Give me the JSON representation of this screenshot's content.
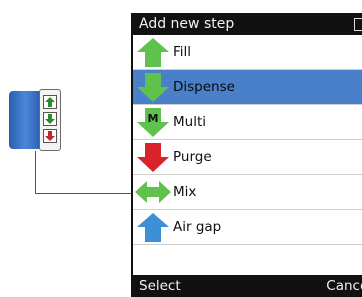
{
  "menu": {
    "title": "Add new step",
    "items": [
      {
        "label": "Fill",
        "icon": "fill-up-arrow-icon",
        "selected": false
      },
      {
        "label": "Dispense",
        "icon": "dispense-down-arrow-icon",
        "selected": true
      },
      {
        "label": "Multi",
        "icon": "multi-dispense-icon",
        "selected": false
      },
      {
        "label": "Purge",
        "icon": "purge-down-arrow-icon",
        "selected": false
      },
      {
        "label": "Mix",
        "icon": "mix-double-arrow-icon",
        "selected": false
      },
      {
        "label": "Air gap",
        "icon": "air-gap-up-arrow-icon",
        "selected": false
      }
    ],
    "multi_badge": "M"
  },
  "softkeys": {
    "left": "Select",
    "right": "Cancel"
  },
  "colors": {
    "selected_row": "#4a80c9",
    "green_arrow": "#5ec24c",
    "red_arrow": "#d8232a",
    "blue_arrow": "#3d8fd6",
    "connector": "#c0262a",
    "bar": "#111111"
  }
}
